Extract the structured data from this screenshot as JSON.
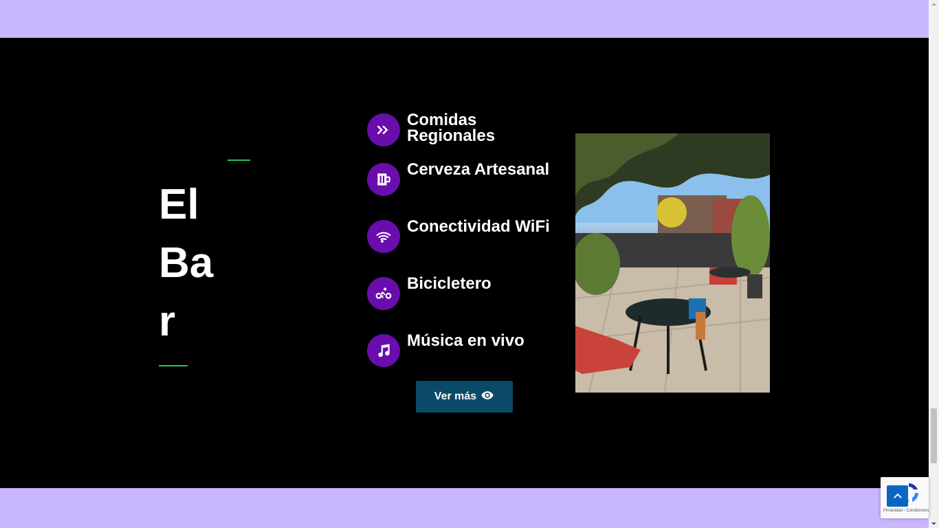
{
  "section": {
    "title": "El Bar",
    "features": [
      {
        "label": "Comidas Regionales",
        "icon": "double-chevron-right-icon"
      },
      {
        "label": "Cerveza Artesanal",
        "icon": "beer-mug-icon"
      },
      {
        "label": "Conectividad WiFi",
        "icon": "wifi-icon"
      },
      {
        "label": "Bicicletero",
        "icon": "bicycle-icon"
      },
      {
        "label": "Música en vivo",
        "icon": "music-note-icon"
      }
    ],
    "button_label": "Ver más",
    "button_icon": "eye-icon"
  },
  "recaptcha": {
    "text": "Privacidad - Condiciones"
  },
  "colors": {
    "band": "#c8b6ff",
    "section_bg": "#000000",
    "icon_circle": "#6a0dad",
    "accent_line": "#22c55e",
    "button_bg": "#0b4a66",
    "back_to_top": "#0a66c2"
  }
}
